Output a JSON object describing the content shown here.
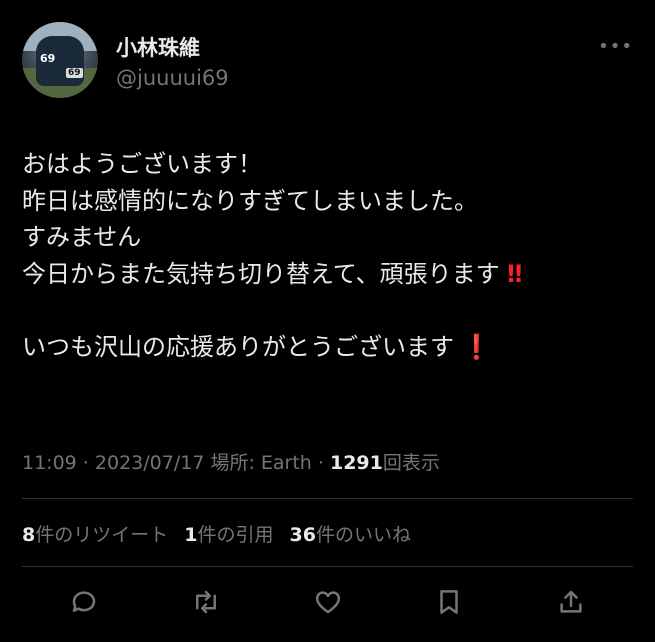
{
  "user": {
    "display_name": "小林珠維",
    "handle": "@juuuui69"
  },
  "avatar": {
    "jersey_number": "69"
  },
  "tweet": {
    "lines": [
      "おはようございます！",
      "昨日は感情的になりすぎてしまいました。",
      "すみません",
      "今日からまた気持ち切り替えて、頑張ります",
      "",
      "いつも沢山の応援ありがとうございます"
    ],
    "emoji_double": "‼",
    "emoji_single": "❗"
  },
  "meta": {
    "time": "11:09",
    "date": "2023/07/17",
    "location": "場所: Earth",
    "views_count": "1291",
    "views_label": "回表示"
  },
  "stats": {
    "retweets_count": "8",
    "retweets_label": "件のリツイート",
    "quotes_count": "1",
    "quotes_label": "件の引用",
    "likes_count": "36",
    "likes_label": "件のいいね"
  },
  "colors": {
    "background": "#000000",
    "text": "#e7e9ea",
    "secondary": "#71767b",
    "accent_red": "#f4212e"
  },
  "actions": [
    "reply-icon",
    "retweet-icon",
    "like-icon",
    "bookmark-icon",
    "share-icon"
  ]
}
